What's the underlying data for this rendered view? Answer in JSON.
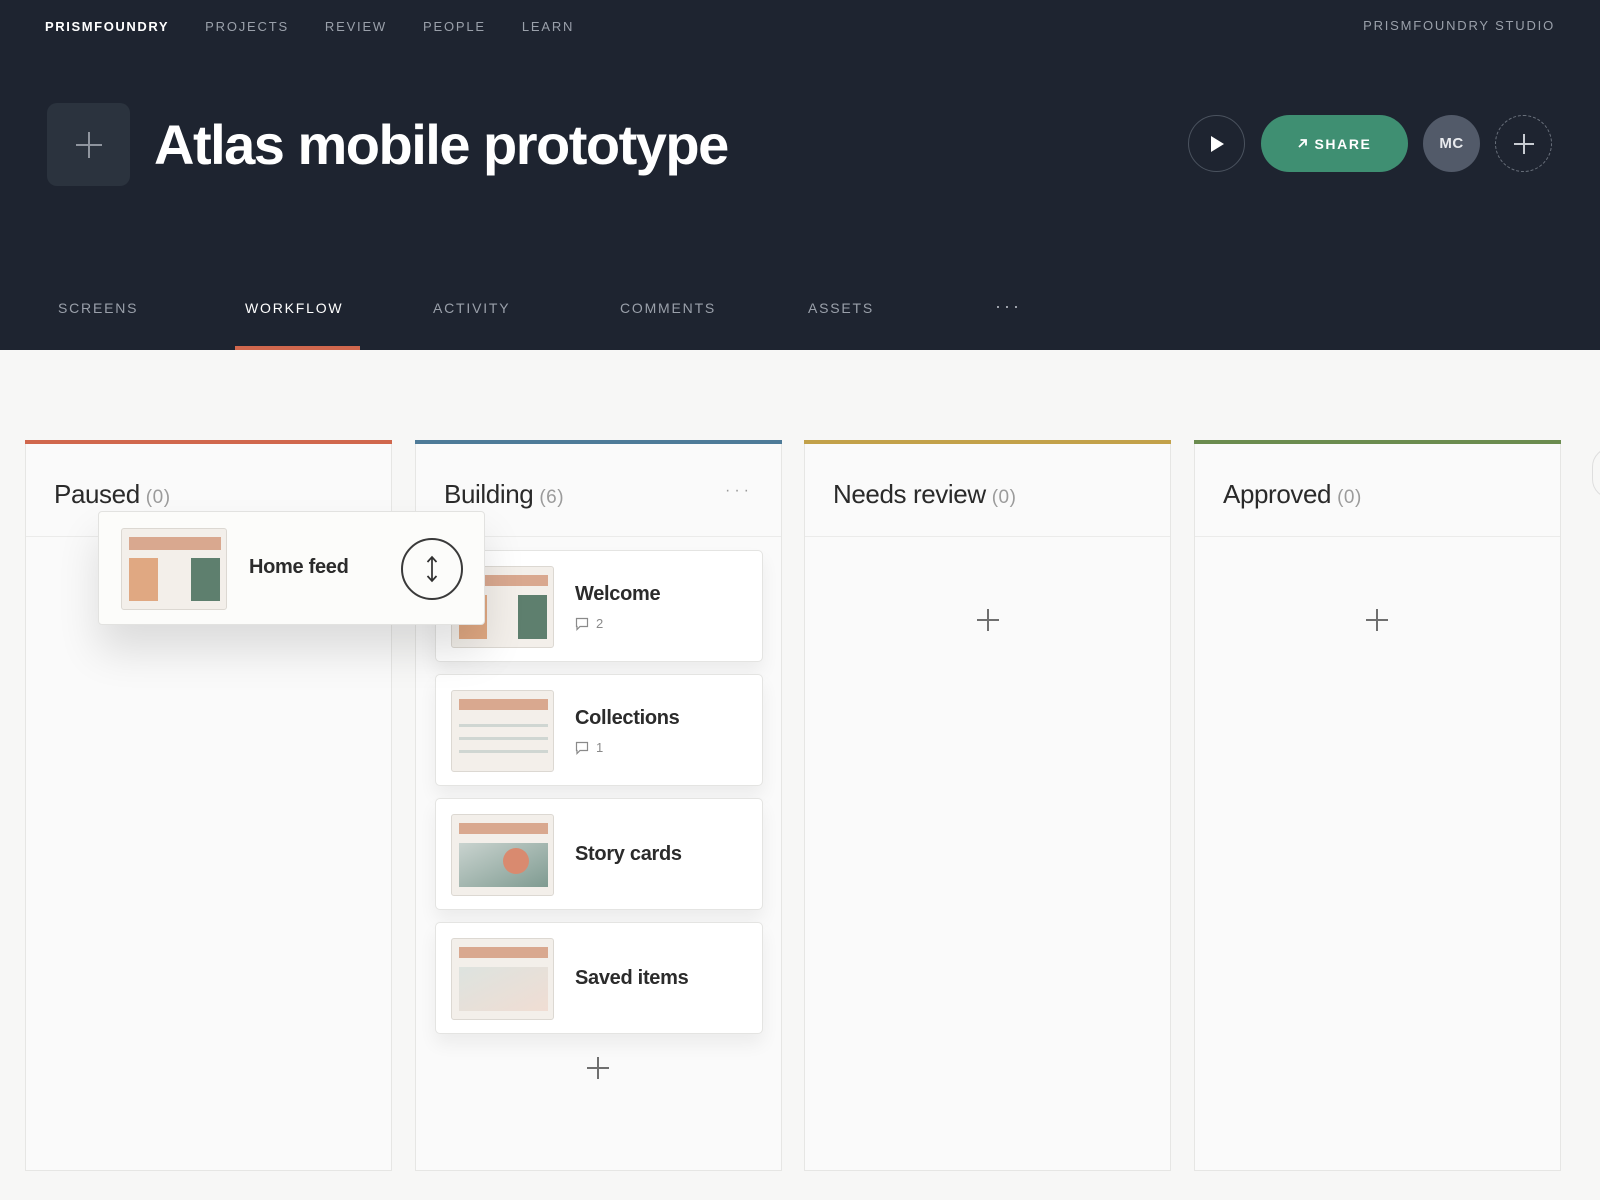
{
  "app": {
    "brand": "PRISMFOUNDRY",
    "nav": [
      "PROJECTS",
      "REVIEW",
      "PEOPLE",
      "LEARN"
    ],
    "workspace": "PRISMFOUNDRY STUDIO"
  },
  "project": {
    "title": "Atlas mobile prototype",
    "share_label": "SHARE",
    "avatar_initials": "MC"
  },
  "tabs": {
    "items": [
      "SCREENS",
      "WORKFLOW",
      "ACTIVITY",
      "COMMENTS",
      "ASSETS"
    ],
    "active": "WORKFLOW",
    "more": "···"
  },
  "columns": [
    {
      "title": "Paused",
      "count": "(0)",
      "accent": "#d0674d"
    },
    {
      "title": "Building",
      "count": "(6)",
      "accent": "#4e7b98",
      "menu": "···"
    },
    {
      "title": "Needs review",
      "count": "(0)",
      "accent": "#c2a14a"
    },
    {
      "title": "Approved",
      "count": "(0)",
      "accent": "#6b8c4f"
    }
  ],
  "cards": [
    {
      "title": "Welcome",
      "comments": "2",
      "thumb": "split"
    },
    {
      "title": "Collections",
      "comments": "1",
      "thumb": "lines"
    },
    {
      "title": "Story cards",
      "thumb": "image"
    },
    {
      "title": "Saved items",
      "thumb": "gradient"
    }
  ],
  "dragging": {
    "title": "Home feed",
    "thumb": "split"
  },
  "colors": {
    "header_bg": "#1e2430",
    "accent_tab": "#d0674d",
    "share_green": "#3f8f72",
    "thumb_bar": "#d9a88f",
    "thumb_orange": "#e0a882",
    "thumb_green": "#5e7f6e"
  }
}
